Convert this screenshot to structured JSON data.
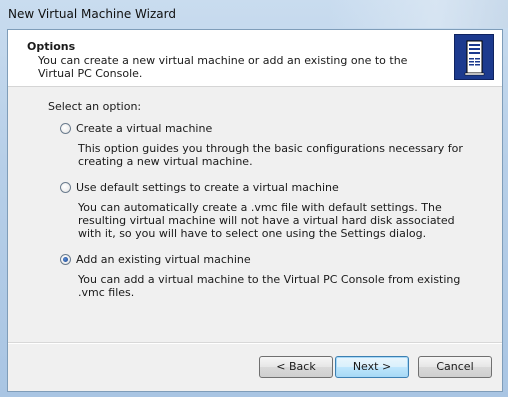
{
  "window": {
    "title": "New Virtual Machine Wizard"
  },
  "header": {
    "title": "Options",
    "description": "You can create a new virtual machine or add an existing one to the Virtual PC Console.",
    "icon": "server-icon"
  },
  "prompt": "Select an option:",
  "options": [
    {
      "label": "Create a virtual machine",
      "description": "This option guides you through the basic configurations necessary for creating a new virtual machine.",
      "selected": false
    },
    {
      "label": "Use default settings to create a virtual machine",
      "description": "You can automatically create a .vmc file with default settings. The resulting virtual machine will not have a virtual hard disk associated with it, so you will have to select one using the Settings dialog.",
      "selected": false
    },
    {
      "label": "Add an existing virtual machine",
      "description": "You can add a virtual machine to the Virtual PC Console from existing .vmc files.",
      "selected": true
    }
  ],
  "buttons": {
    "back": "< Back",
    "next": "Next >",
    "cancel": "Cancel"
  },
  "colors": {
    "header_bg": "#ffffff",
    "dialog_bg": "#f0f0f0",
    "icon_bg": "#1c3a8e"
  }
}
